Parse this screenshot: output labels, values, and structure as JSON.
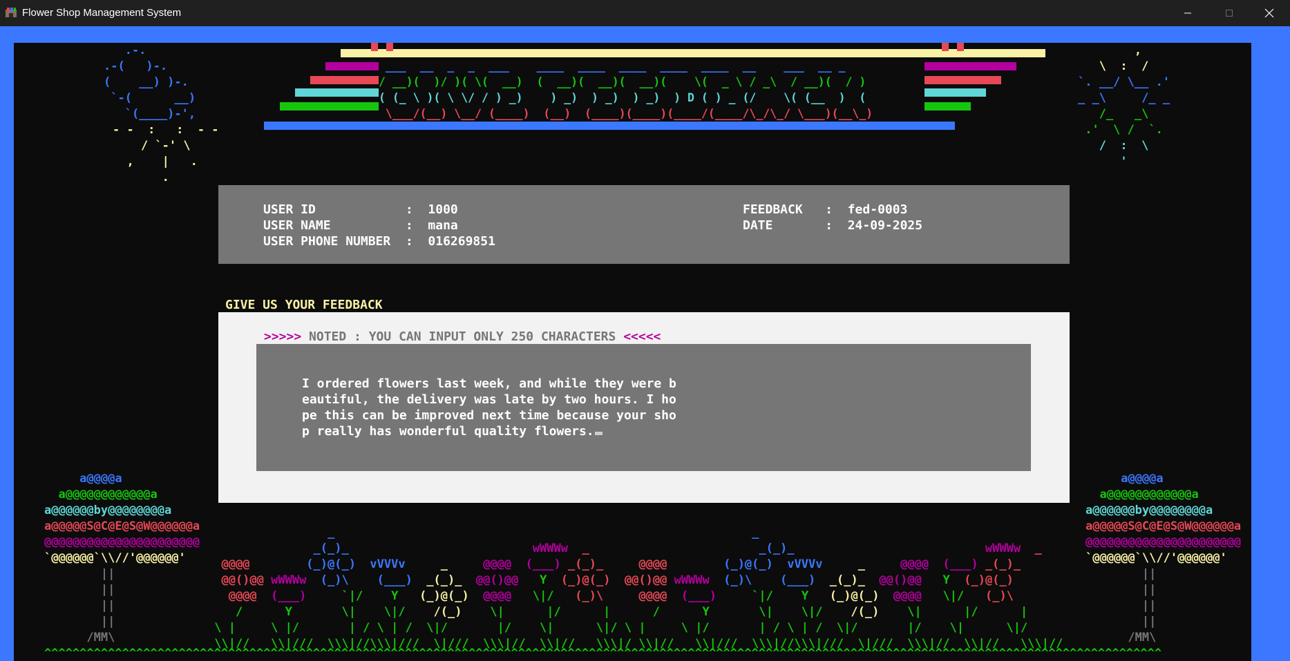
{
  "window": {
    "title": "Flower Shop Management System",
    "minimize_icon": "minimize-icon",
    "maximize_icon": "maximize-icon",
    "close_icon": "close-icon"
  },
  "colors": {
    "blue": "#3b78ff",
    "magenta": "#b4009e",
    "red": "#e74856",
    "cyan": "#61d6d6",
    "green": "#16c60c",
    "yellow": "#f9f1a5",
    "gray": "#767676",
    "light": "#f2f2f2"
  },
  "banner": {
    "line1": " ___  __  _  _  ___    ____  ____  ____  ____  ____  __    ___  __ _ ",
    "line2": "/ __)(  )/ )( \\(  __)  (  __)(  __)(  __)(    \\(  _ \\ / _\\  / __)(  / )",
    "line3": "( (_ \\ )( \\ \\/ / ) _)    ) _)  ) _)  ) _)  ) D ( ) _ (/    \\( (__  )  ( ",
    "line4": " \\___/(__) \\__/ (____)  (__)  (____)(____)(____/(____/\\_/\\_/ \\___)(__\\_)"
  },
  "art": {
    "cloud": [
      "   .-.",
      ".-(   )-.",
      "(    __) )-.",
      " `-(      __)",
      "   `(____)-',",
      "- -  :   :  - -",
      "    / `-' \\",
      "  ,    |   .",
      "       ."
    ],
    "sun": [
      "        ,",
      "   \\  :  /",
      "`. __/ \\__ .'",
      "_ _\\     /_ _",
      "   /_   _\\",
      " .'  \\ /  `.",
      "   /  :  \\",
      "      '"
    ],
    "tree": [
      "     a@@@@a",
      "  a@@@@@@@@@@@@a",
      "a@@@@@@by@@@@@@@@a",
      "a@@@@@S@C@E@S@W@@@@@@a",
      "@@@@@@@@@@@@@@@@@@@@@@",
      "`@@@@@@`\\\\//'@@@@@@'",
      "        ||",
      "        ||",
      "        ||",
      "        ||",
      "      /MM\\"
    ],
    "grass": "^^^^^^^^^^^^^^^^^^^^^^^^^^^^^^^^^^^^^^^^^^^^^^^^^^^^^^^^^^^^^^^^^^^^^^^^^^^^^^^^^^^^^^^^^^^^^^^^^^^^^^^^^^^^^^^^^^^^^^^^^^^^^^^^^^^^^^^^^^^^^^^^^^^^^^^^^^^^^^"
  },
  "user_info": {
    "user_id": "USER ID            :  1000",
    "user_name": "USER NAME          :  mana",
    "user_phone": "USER PHONE NUMBER  :  016269851",
    "feedback": "FEEDBACK   :  fed-0003",
    "date": "DATE       :  24-09-2025"
  },
  "feedback_form": {
    "heading": "GIVE US YOUR FEEDBACK",
    "note_prefix": ">>>>>",
    "note": " NOTED : YOU CAN INPUT ONLY 250 CHARACTERS ",
    "note_suffix": "<<<<<",
    "lines": [
      "I ordered flowers last week, and while they were b",
      "eautiful, the delivery was late by two hours. I ho",
      "pe this can be improved next time because your sho",
      "p really has wonderful quality flowers."
    ]
  }
}
